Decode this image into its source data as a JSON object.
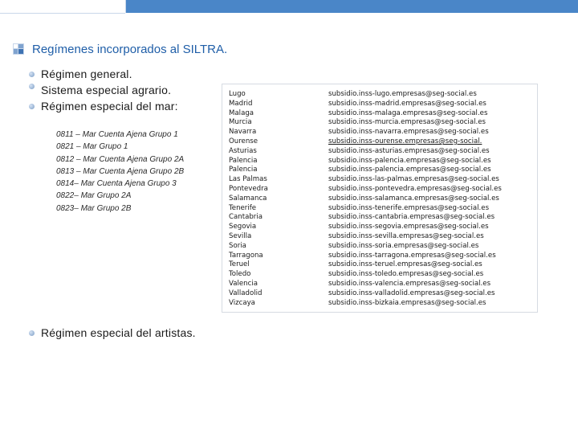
{
  "title": "Regímenes incorporados al SILTRA.",
  "title_icon": "slide-bullet-icon",
  "colors": {
    "accent": "#4a86c8",
    "title": "#1f5ea8"
  },
  "bullets": [
    "Régimen general.",
    "Sistema especial agrario.",
    "Régimen especial del mar:"
  ],
  "codes": [
    "0811 – Mar Cuenta Ajena Grupo 1",
    "0821 – Mar Grupo 1",
    "0812 – Mar Cuenta Ajena Grupo 2A",
    "0813 – Mar Cuenta Ajena Grupo 2B",
    "0814– Mar Cuenta Ajena Grupo 3",
    "0822– Mar Grupo 2A",
    "0823– Mar Grupo 2B"
  ],
  "email_table": {
    "rows": [
      [
        "Lugo",
        "subsidio.inss-lugo.empresas@seg-social.es"
      ],
      [
        "Madrid",
        "subsidio.inss-madrid.empresas@seg-social.es"
      ],
      [
        "Malaga",
        "subsidio.inss-malaga.empresas@seg-social.es"
      ],
      [
        "Murcia",
        "subsidio.inss-murcia.empresas@seg-social.es"
      ],
      [
        "Navarra",
        "subsidio.inss-navarra.empresas@seg-social.es"
      ],
      [
        "Ourense",
        "subsidio.inss-ourense.empresas@seg-social."
      ],
      [
        "Asturias",
        "subsidio.inss-asturias.empresas@seg-social.es"
      ],
      [
        "Palencia",
        "subsidio.inss-palencia.empresas@seg-social.es"
      ],
      [
        "Palencia",
        "subsidio.inss-palencia.empresas@seg-social.es"
      ],
      [
        "Las Palmas",
        "subsidio.inss-las-palmas.empresas@seg-social.es"
      ],
      [
        "Pontevedra",
        "subsidio.inss-pontevedra.empresas@seg-social.es"
      ],
      [
        "Salamanca",
        "subsidio.inss-salamanca.empresas@seg-social.es"
      ],
      [
        "Tenerife",
        "subsidio.inss-tenerife.empresas@seg-social.es"
      ],
      [
        "Cantabria",
        "subsidio.inss-cantabria.empresas@seg-social.es"
      ],
      [
        "Segovia",
        "subsidio.inss-segovia.empresas@seg-social.es"
      ],
      [
        "Sevilla",
        "subsidio.inss-sevilla.empresas@seg-social.es"
      ],
      [
        "Soria",
        "subsidio.inss-soria.empresas@seg-social.es"
      ],
      [
        "Tarragona",
        "subsidio.inss-tarragona.empresas@seg-social.es"
      ],
      [
        "Teruel",
        "subsidio.inss-teruel.empresas@seg-social.es"
      ],
      [
        "Toledo",
        "subsidio.inss-toledo.empresas@seg-social.es"
      ],
      [
        "Valencia",
        "subsidio.inss-valencia.empresas@seg-social.es"
      ],
      [
        "Valladolid",
        "subsidio.inss-valladolid.empresas@seg-social.es"
      ],
      [
        "Vizcaya",
        "subsidio.inss-bizkaia.empresas@seg-social.es"
      ]
    ],
    "underlined_row": 5
  },
  "final_bullet": "Régimen especial del artistas."
}
